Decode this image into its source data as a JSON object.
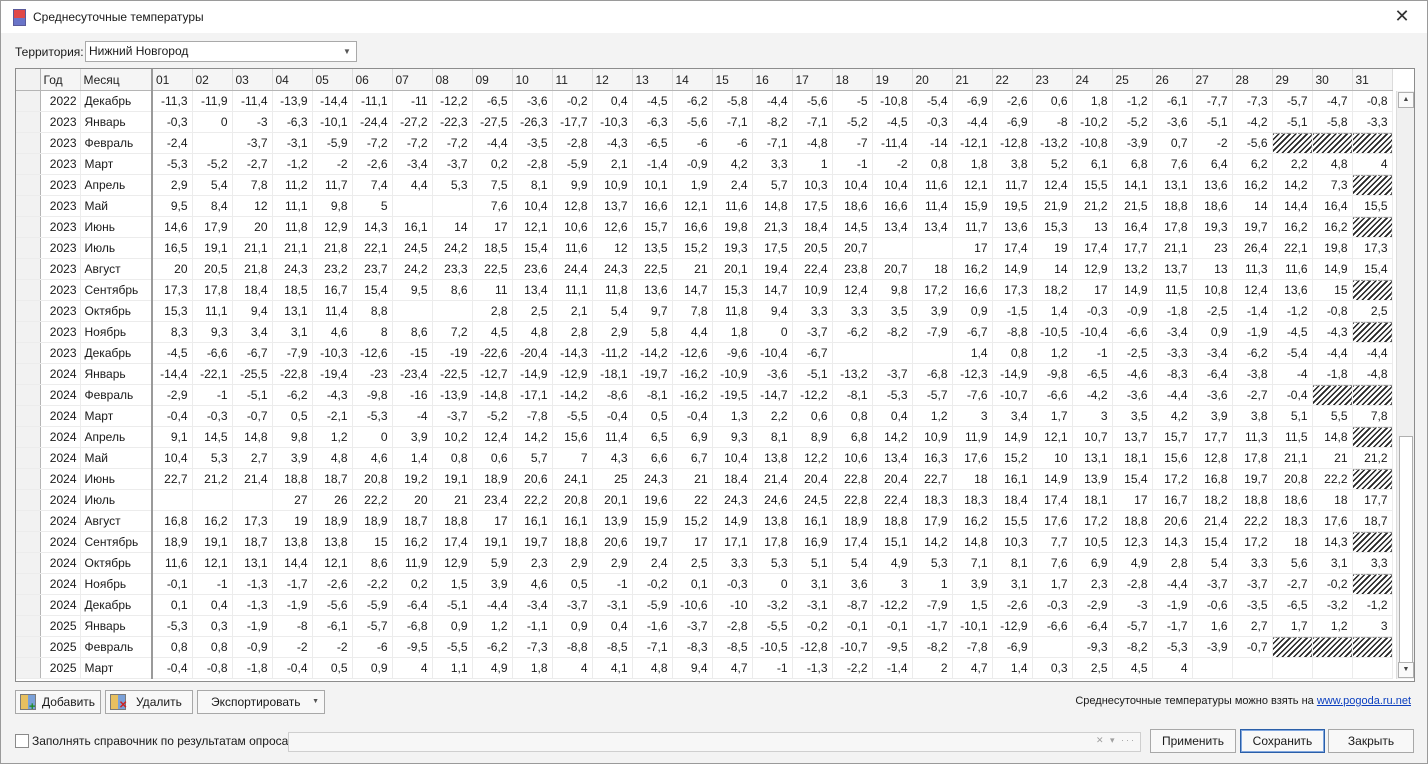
{
  "window": {
    "title": "Среднесуточные температуры",
    "close_symbol": "✕"
  },
  "territory": {
    "label": "Территория:",
    "value": "Нижний Новгород"
  },
  "grid": {
    "columns": {
      "year": "Год",
      "month": "Месяц",
      "days": [
        "01",
        "02",
        "03",
        "04",
        "05",
        "06",
        "07",
        "08",
        "09",
        "10",
        "11",
        "12",
        "13",
        "14",
        "15",
        "16",
        "17",
        "18",
        "19",
        "20",
        "21",
        "22",
        "23",
        "24",
        "25",
        "26",
        "27",
        "28",
        "29",
        "30",
        "31"
      ]
    },
    "rows": [
      {
        "year": "2022",
        "month": "Декабрь",
        "t": [
          "-11,3",
          "-11,9",
          "-11,4",
          "-13,9",
          "-14,4",
          "-11,1",
          "-11",
          "-12,2",
          "-6,5",
          "-3,6",
          "-0,2",
          "0,4",
          "-4,5",
          "-6,2",
          "-5,8",
          "-4,4",
          "-5,6",
          "-5",
          "-10,8",
          "-5,4",
          "-6,9",
          "-2,6",
          "0,6",
          "1,8",
          "-1,2",
          "-6,1",
          "-7,7",
          "-7,3",
          "-5,7",
          "-4,7",
          "-0,8"
        ]
      },
      {
        "year": "2023",
        "month": "Январь",
        "t": [
          "-0,3",
          "0",
          "-3",
          "-6,3",
          "-10,1",
          "-24,4",
          "-27,2",
          "-22,3",
          "-27,5",
          "-26,3",
          "-17,7",
          "-10,3",
          "-6,3",
          "-5,6",
          "-7,1",
          "-8,2",
          "-7,1",
          "-5,2",
          "-4,5",
          "-0,3",
          "-4,4",
          "-6,9",
          "-8",
          "-10,2",
          "-5,2",
          "-3,6",
          "-5,1",
          "-4,2",
          "-5,1",
          "-5,8",
          "-3,3"
        ]
      },
      {
        "year": "2023",
        "month": "Февраль",
        "t": [
          "-2,4",
          "",
          "-3,7",
          "-3,1",
          "-5,9",
          "-7,2",
          "-7,2",
          "-7,2",
          "-4,4",
          "-3,5",
          "-2,8",
          "-4,3",
          "-6,5",
          "-6",
          "-6",
          "-7,1",
          "-4,8",
          "-7",
          "-11,4",
          "-14",
          "-12,1",
          "-12,8",
          "-13,2",
          "-10,8",
          "-3,9",
          "0,7",
          "-2",
          "-5,6",
          "#",
          "#",
          "#"
        ]
      },
      {
        "year": "2023",
        "month": "Март",
        "t": [
          "-5,3",
          "-5,2",
          "-2,7",
          "-1,2",
          "-2",
          "-2,6",
          "-3,4",
          "-3,7",
          "0,2",
          "-2,8",
          "-5,9",
          "2,1",
          "-1,4",
          "-0,9",
          "4,2",
          "3,3",
          "1",
          "-1",
          "-2",
          "0,8",
          "1,8",
          "3,8",
          "5,2",
          "6,1",
          "6,8",
          "7,6",
          "6,4",
          "6,2",
          "2,2",
          "4,8",
          "4"
        ]
      },
      {
        "year": "2023",
        "month": "Апрель",
        "t": [
          "2,9",
          "5,4",
          "7,8",
          "11,2",
          "11,7",
          "7,4",
          "4,4",
          "5,3",
          "7,5",
          "8,1",
          "9,9",
          "10,9",
          "10,1",
          "1,9",
          "2,4",
          "5,7",
          "10,3",
          "10,4",
          "10,4",
          "11,6",
          "12,1",
          "11,7",
          "12,4",
          "15,5",
          "14,1",
          "13,1",
          "13,6",
          "16,2",
          "14,2",
          "7,3",
          "#"
        ]
      },
      {
        "year": "2023",
        "month": "Май",
        "t": [
          "9,5",
          "8,4",
          "12",
          "11,1",
          "9,8",
          "5",
          "",
          "",
          "7,6",
          "10,4",
          "12,8",
          "13,7",
          "16,6",
          "12,1",
          "11,6",
          "14,8",
          "17,5",
          "18,6",
          "16,6",
          "11,4",
          "15,9",
          "19,5",
          "21,9",
          "21,2",
          "21,5",
          "18,8",
          "18,6",
          "14",
          "14,4",
          "16,4",
          "15,5"
        ]
      },
      {
        "year": "2023",
        "month": "Июнь",
        "t": [
          "14,6",
          "17,9",
          "20",
          "11,8",
          "12,9",
          "14,3",
          "16,1",
          "14",
          "17",
          "12,1",
          "10,6",
          "12,6",
          "15,7",
          "16,6",
          "19,8",
          "21,3",
          "18,4",
          "14,5",
          "13,4",
          "13,4",
          "11,7",
          "13,6",
          "15,3",
          "13",
          "16,4",
          "17,8",
          "19,3",
          "19,7",
          "16,2",
          "16,2",
          "#"
        ]
      },
      {
        "year": "2023",
        "month": "Июль",
        "t": [
          "16,5",
          "19,1",
          "21,1",
          "21,1",
          "21,8",
          "22,1",
          "24,5",
          "24,2",
          "18,5",
          "15,4",
          "11,6",
          "12",
          "13,5",
          "15,2",
          "19,3",
          "17,5",
          "20,5",
          "20,7",
          "",
          "",
          "17",
          "17,4",
          "19",
          "17,4",
          "17,7",
          "21,1",
          "23",
          "26,4",
          "22,1",
          "19,8",
          "17,3"
        ]
      },
      {
        "year": "2023",
        "month": "Август",
        "t": [
          "20",
          "20,5",
          "21,8",
          "24,3",
          "23,2",
          "23,7",
          "24,2",
          "23,3",
          "22,5",
          "23,6",
          "24,4",
          "24,3",
          "22,5",
          "21",
          "20,1",
          "19,4",
          "22,4",
          "23,8",
          "20,7",
          "18",
          "16,2",
          "14,9",
          "14",
          "12,9",
          "13,2",
          "13,7",
          "13",
          "11,3",
          "11,6",
          "14,9",
          "15,4"
        ]
      },
      {
        "year": "2023",
        "month": "Сентябрь",
        "t": [
          "17,3",
          "17,8",
          "18,4",
          "18,5",
          "16,7",
          "15,4",
          "9,5",
          "8,6",
          "11",
          "13,4",
          "11,1",
          "11,8",
          "13,6",
          "14,7",
          "15,3",
          "14,7",
          "10,9",
          "12,4",
          "9,8",
          "17,2",
          "16,6",
          "17,3",
          "18,2",
          "17",
          "14,9",
          "11,5",
          "10,8",
          "12,4",
          "13,6",
          "15",
          "#"
        ]
      },
      {
        "year": "2023",
        "month": "Октябрь",
        "t": [
          "15,3",
          "11,1",
          "9,4",
          "13,1",
          "11,4",
          "8,8",
          "",
          "",
          "2,8",
          "2,5",
          "2,1",
          "5,4",
          "9,7",
          "7,8",
          "11,8",
          "9,4",
          "3,3",
          "3,3",
          "3,5",
          "3,9",
          "0,9",
          "-1,5",
          "1,4",
          "-0,3",
          "-0,9",
          "-1,8",
          "-2,5",
          "-1,4",
          "-1,2",
          "-0,8",
          "2,5"
        ]
      },
      {
        "year": "2023",
        "month": "Ноябрь",
        "t": [
          "8,3",
          "9,3",
          "3,4",
          "3,1",
          "4,6",
          "8",
          "8,6",
          "7,2",
          "4,5",
          "4,8",
          "2,8",
          "2,9",
          "5,8",
          "4,4",
          "1,8",
          "0",
          "-3,7",
          "-6,2",
          "-8,2",
          "-7,9",
          "-6,7",
          "-8,8",
          "-10,5",
          "-10,4",
          "-6,6",
          "-3,4",
          "0,9",
          "-1,9",
          "-4,5",
          "-4,3",
          "#"
        ]
      },
      {
        "year": "2023",
        "month": "Декабрь",
        "t": [
          "-4,5",
          "-6,6",
          "-6,7",
          "-7,9",
          "-10,3",
          "-12,6",
          "-15",
          "-19",
          "-22,6",
          "-20,4",
          "-14,3",
          "-11,2",
          "-14,2",
          "-12,6",
          "-9,6",
          "-10,4",
          "-6,7",
          "",
          "",
          "",
          "1,4",
          "0,8",
          "1,2",
          "-1",
          "-2,5",
          "-3,3",
          "-3,4",
          "-6,2",
          "-5,4",
          "-4,4",
          "-4,4"
        ]
      },
      {
        "year": "2024",
        "month": "Январь",
        "t": [
          "-14,4",
          "-22,1",
          "-25,5",
          "-22,8",
          "-19,4",
          "-23",
          "-23,4",
          "-22,5",
          "-12,7",
          "-14,9",
          "-12,9",
          "-18,1",
          "-19,7",
          "-16,2",
          "-10,9",
          "-3,6",
          "-5,1",
          "-13,2",
          "-3,7",
          "-6,8",
          "-12,3",
          "-14,9",
          "-9,8",
          "-6,5",
          "-4,6",
          "-8,3",
          "-6,4",
          "-3,8",
          "-4",
          "-1,8",
          "-4,8"
        ]
      },
      {
        "year": "2024",
        "month": "Февраль",
        "t": [
          "-2,9",
          "-1",
          "-5,1",
          "-6,2",
          "-4,3",
          "-9,8",
          "-16",
          "-13,9",
          "-14,8",
          "-17,1",
          "-14,2",
          "-8,6",
          "-8,1",
          "-16,2",
          "-19,5",
          "-14,7",
          "-12,2",
          "-8,1",
          "-5,3",
          "-5,7",
          "-7,6",
          "-10,7",
          "-6,6",
          "-4,2",
          "-3,6",
          "-4,4",
          "-3,6",
          "-2,7",
          "-0,4",
          "#",
          "#"
        ]
      },
      {
        "year": "2024",
        "month": "Март",
        "t": [
          "-0,4",
          "-0,3",
          "-0,7",
          "0,5",
          "-2,1",
          "-5,3",
          "-4",
          "-3,7",
          "-5,2",
          "-7,8",
          "-5,5",
          "-0,4",
          "0,5",
          "-0,4",
          "1,3",
          "2,2",
          "0,6",
          "0,8",
          "0,4",
          "1,2",
          "3",
          "3,4",
          "1,7",
          "3",
          "3,5",
          "4,2",
          "3,9",
          "3,8",
          "5,1",
          "5,5",
          "7,8"
        ]
      },
      {
        "year": "2024",
        "month": "Апрель",
        "t": [
          "9,1",
          "14,5",
          "14,8",
          "9,8",
          "1,2",
          "0",
          "3,9",
          "10,2",
          "12,4",
          "14,2",
          "15,6",
          "11,4",
          "6,5",
          "6,9",
          "9,3",
          "8,1",
          "8,9",
          "6,8",
          "14,2",
          "10,9",
          "11,9",
          "14,9",
          "12,1",
          "10,7",
          "13,7",
          "15,7",
          "17,7",
          "11,3",
          "11,5",
          "14,8",
          "#"
        ]
      },
      {
        "year": "2024",
        "month": "Май",
        "t": [
          "10,4",
          "5,3",
          "2,7",
          "3,9",
          "4,8",
          "4,6",
          "1,4",
          "0,8",
          "0,6",
          "5,7",
          "7",
          "4,3",
          "6,6",
          "6,7",
          "10,4",
          "13,8",
          "12,2",
          "10,6",
          "13,4",
          "16,3",
          "17,6",
          "15,2",
          "10",
          "13,1",
          "18,1",
          "15,6",
          "12,8",
          "17,8",
          "21,1",
          "21",
          "21,2"
        ]
      },
      {
        "year": "2024",
        "month": "Июнь",
        "t": [
          "22,7",
          "21,2",
          "21,4",
          "18,8",
          "18,7",
          "20,8",
          "19,2",
          "19,1",
          "18,9",
          "20,6",
          "24,1",
          "25",
          "24,3",
          "21",
          "18,4",
          "21,4",
          "20,4",
          "22,8",
          "20,4",
          "22,7",
          "18",
          "16,1",
          "14,9",
          "13,9",
          "15,4",
          "17,2",
          "16,8",
          "19,7",
          "20,8",
          "22,2",
          "#"
        ]
      },
      {
        "year": "2024",
        "month": "Июль",
        "t": [
          "",
          "",
          "",
          "27",
          "26",
          "22,2",
          "20",
          "21",
          "23,4",
          "22,2",
          "20,8",
          "20,1",
          "19,6",
          "22",
          "24,3",
          "24,6",
          "24,5",
          "22,8",
          "22,4",
          "18,3",
          "18,3",
          "18,4",
          "17,4",
          "18,1",
          "17",
          "16,7",
          "18,2",
          "18,8",
          "18,6",
          "18",
          "17,7"
        ]
      },
      {
        "year": "2024",
        "month": "Август",
        "t": [
          "16,8",
          "16,2",
          "17,3",
          "19",
          "18,9",
          "18,9",
          "18,7",
          "18,8",
          "17",
          "16,1",
          "16,1",
          "13,9",
          "15,9",
          "15,2",
          "14,9",
          "13,8",
          "16,1",
          "18,9",
          "18,8",
          "17,9",
          "16,2",
          "15,5",
          "17,6",
          "17,2",
          "18,8",
          "20,6",
          "21,4",
          "22,2",
          "18,3",
          "17,6",
          "18,7"
        ]
      },
      {
        "year": "2024",
        "month": "Сентябрь",
        "t": [
          "18,9",
          "19,1",
          "18,7",
          "13,8",
          "13,8",
          "15",
          "16,2",
          "17,4",
          "19,1",
          "19,7",
          "18,8",
          "20,6",
          "19,7",
          "17",
          "17,1",
          "17,8",
          "16,9",
          "17,4",
          "15,1",
          "14,2",
          "14,8",
          "10,3",
          "7,7",
          "10,5",
          "12,3",
          "14,3",
          "15,4",
          "17,2",
          "18",
          "14,3",
          "#"
        ]
      },
      {
        "year": "2024",
        "month": "Октябрь",
        "t": [
          "11,6",
          "12,1",
          "13,1",
          "14,4",
          "12,1",
          "8,6",
          "11,9",
          "12,9",
          "5,9",
          "2,3",
          "2,9",
          "2,9",
          "2,4",
          "2,5",
          "3,3",
          "5,3",
          "5,1",
          "5,4",
          "4,9",
          "5,3",
          "7,1",
          "8,1",
          "7,6",
          "6,9",
          "4,9",
          "2,8",
          "5,4",
          "3,3",
          "5,6",
          "3,1",
          "3,3"
        ]
      },
      {
        "year": "2024",
        "month": "Ноябрь",
        "t": [
          "-0,1",
          "-1",
          "-1,3",
          "-1,7",
          "-2,6",
          "-2,2",
          "0,2",
          "1,5",
          "3,9",
          "4,6",
          "0,5",
          "-1",
          "-0,2",
          "0,1",
          "-0,3",
          "0",
          "3,1",
          "3,6",
          "3",
          "1",
          "3,9",
          "3,1",
          "1,7",
          "2,3",
          "-2,8",
          "-4,4",
          "-3,7",
          "-3,7",
          "-2,7",
          "-0,2",
          "#"
        ]
      },
      {
        "year": "2024",
        "month": "Декабрь",
        "t": [
          "0,1",
          "0,4",
          "-1,3",
          "-1,9",
          "-5,6",
          "-5,9",
          "-6,4",
          "-5,1",
          "-4,4",
          "-3,4",
          "-3,7",
          "-3,1",
          "-5,9",
          "-10,6",
          "-10",
          "-3,2",
          "-3,1",
          "-8,7",
          "-12,2",
          "-7,9",
          "1,5",
          "-2,6",
          "-0,3",
          "-2,9",
          "-3",
          "-1,9",
          "-0,6",
          "-3,5",
          "-6,5",
          "-3,2",
          "-1,2"
        ]
      },
      {
        "year": "2025",
        "month": "Январь",
        "t": [
          "-5,3",
          "0,3",
          "-1,9",
          "-8",
          "-6,1",
          "-5,7",
          "-6,8",
          "0,9",
          "1,2",
          "-1,1",
          "0,9",
          "0,4",
          "-1,6",
          "-3,7",
          "-2,8",
          "-5,5",
          "-0,2",
          "-0,1",
          "-0,1",
          "-1,7",
          "-10,1",
          "-12,9",
          "-6,6",
          "-6,4",
          "-5,7",
          "-1,7",
          "1,6",
          "2,7",
          "1,7",
          "1,2",
          "3"
        ]
      },
      {
        "year": "2025",
        "month": "Февраль",
        "t": [
          "0,8",
          "0,8",
          "-0,9",
          "-2",
          "-2",
          "-6",
          "-9,5",
          "-5,5",
          "-6,2",
          "-7,3",
          "-8,8",
          "-8,5",
          "-7,1",
          "-8,3",
          "-8,5",
          "-10,5",
          "-12,8",
          "-10,7",
          "-9,5",
          "-8,2",
          "-7,8",
          "-6,9",
          "",
          "-9,3",
          "-8,2",
          "-5,3",
          "-3,9",
          "-0,7",
          "#",
          "#",
          "#"
        ]
      },
      {
        "year": "2025",
        "month": "Март",
        "t": [
          "-0,4",
          "-0,8",
          "-1,8",
          "-0,4",
          "0,5",
          "0,9",
          "4",
          "1,1",
          "4,9",
          "1,8",
          "4",
          "4,1",
          "4,8",
          "9,4",
          "4,7",
          "-1",
          "-1,3",
          "-2,2",
          "-1,4",
          "2",
          "4,7",
          "1,4",
          "0,3",
          "2,5",
          "4,5",
          "4",
          "",
          "",
          "",
          "",
          ""
        ]
      }
    ]
  },
  "toolbar": {
    "add_label": "Добавить",
    "delete_label": "Удалить",
    "export_label": "Экспортировать"
  },
  "note": {
    "text": "Среднесуточные температуры можно взять на ",
    "link": "www.pogoda.ru.net"
  },
  "footer": {
    "fill_label": "Заполнять справочник по результатам опроса:",
    "combo_tools": "✕ ▾ ···",
    "apply_label": "Применить",
    "save_label": "Сохранить",
    "close_label": "Закрыть"
  }
}
